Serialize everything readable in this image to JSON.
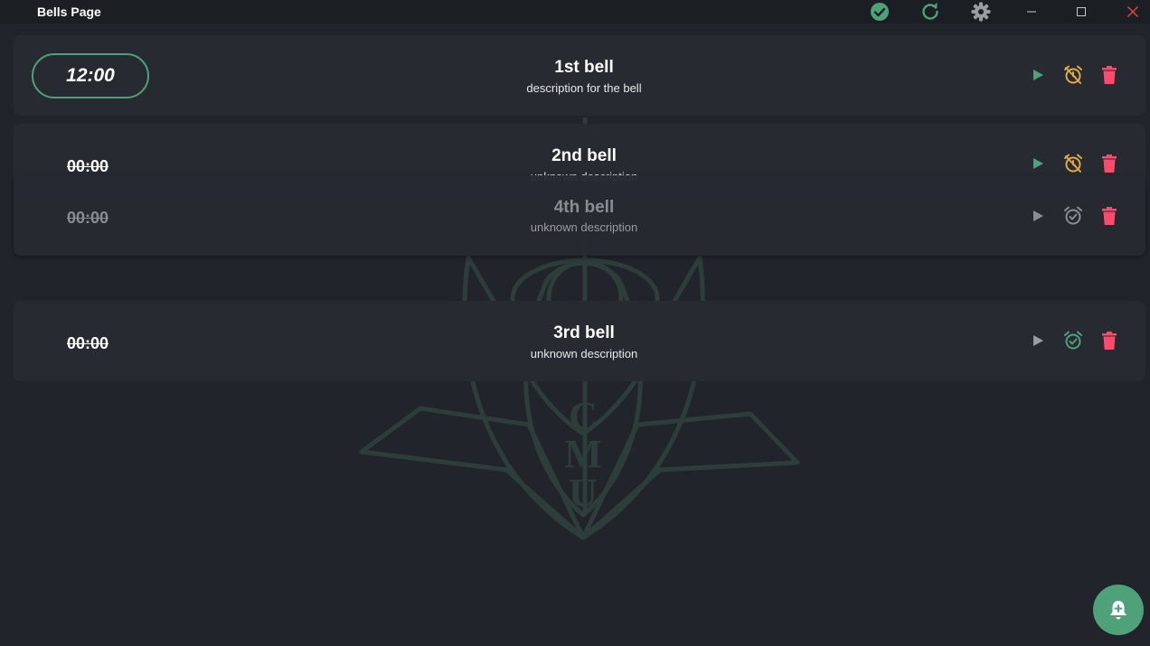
{
  "window": {
    "title": "Bells Page"
  },
  "colors": {
    "accent_green": "#4ea179",
    "alarm_off_orange": "#e0a84a",
    "delete_red": "#ff4a6b",
    "background": "#21242b",
    "card": "#272a31"
  },
  "watermark": {
    "letters": [
      "C",
      "M",
      "U"
    ]
  },
  "bells": [
    {
      "name": "1st bell",
      "description": "description for the bell",
      "time": "12:00",
      "alarm_state": "disabled"
    },
    {
      "name": "2nd bell",
      "description": "unknown description",
      "time": "00:00",
      "alarm_state": "disabled"
    },
    {
      "name": "4th bell",
      "description": "unknown description",
      "time": "00:00",
      "alarm_state": "dimmed"
    },
    {
      "name": "3rd bell",
      "description": "unknown description",
      "time": "00:00",
      "alarm_state": "enabled"
    }
  ]
}
